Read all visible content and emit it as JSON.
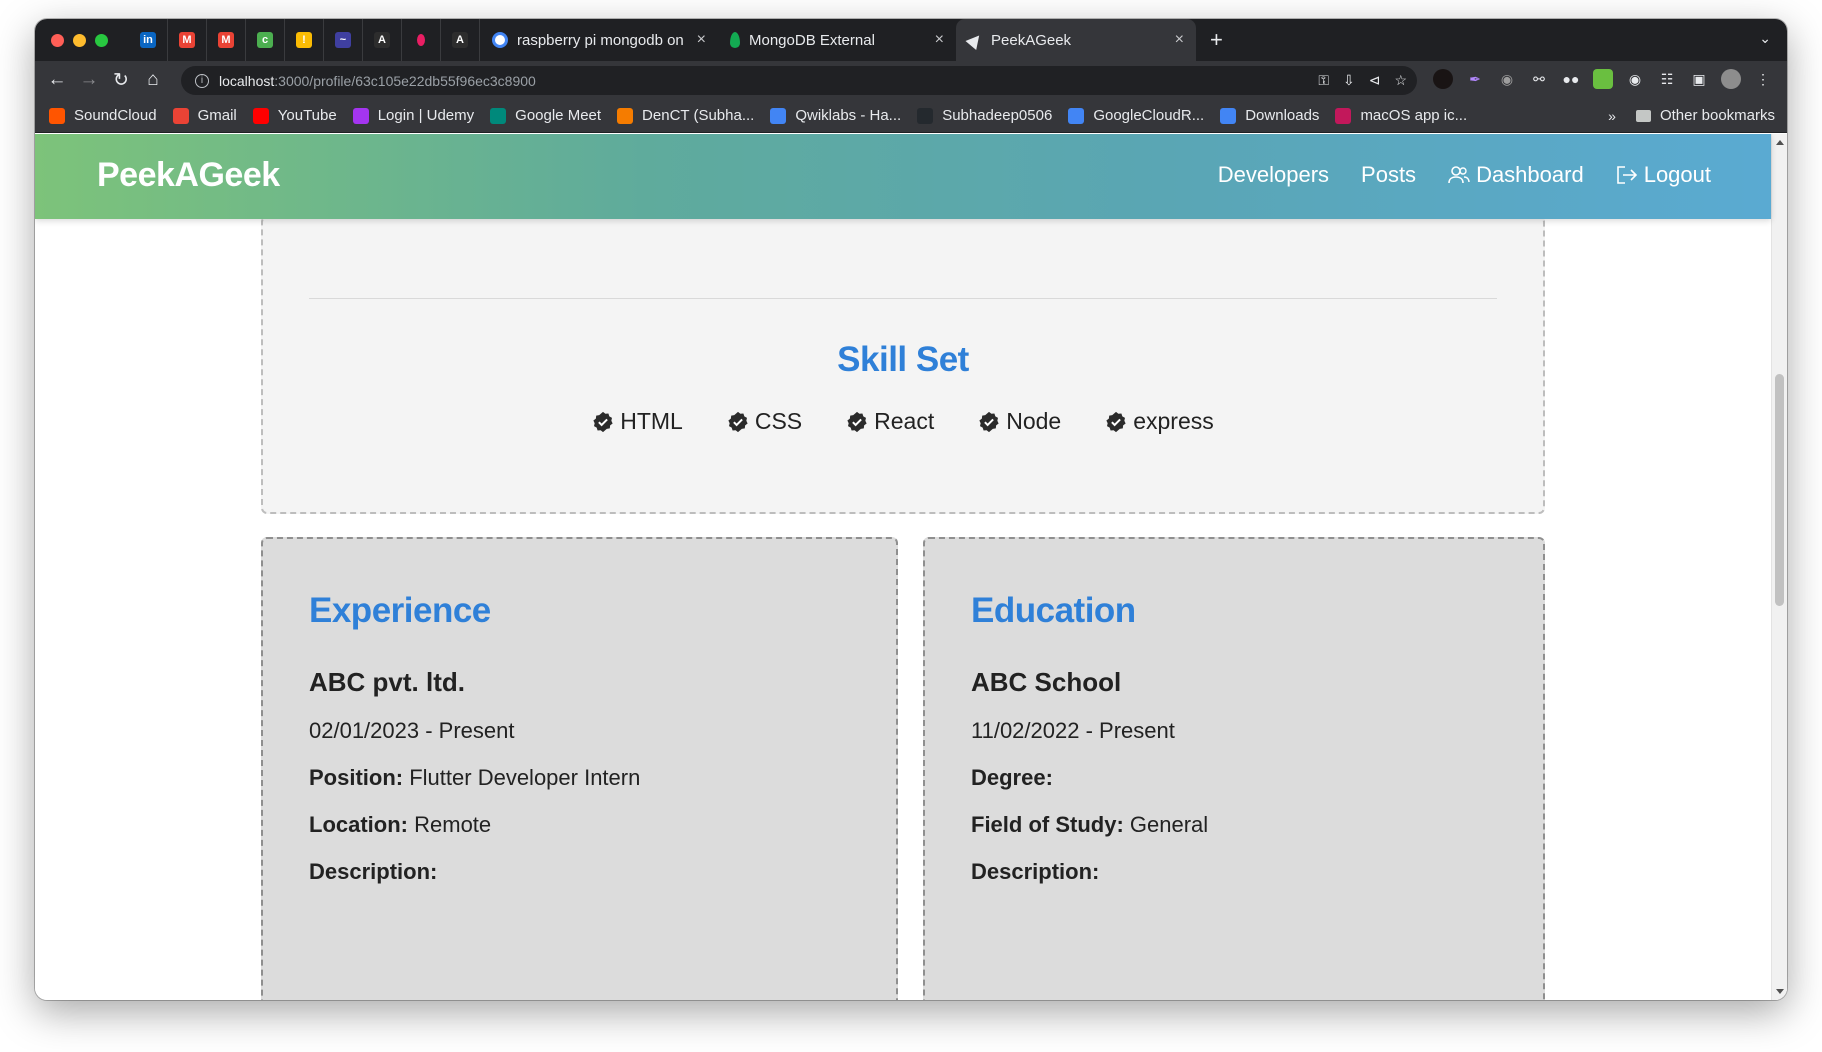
{
  "browser": {
    "tabs": [
      {
        "title": "raspberry pi mongodb on",
        "close": "×"
      },
      {
        "title": "MongoDB External",
        "close": "×"
      },
      {
        "title": "PeekAGeek",
        "close": "×"
      }
    ],
    "new_tab": "+",
    "url_host": "localhost",
    "url_path": ":3000/profile/63c105e22db55f96ec3c8900",
    "bookmarks": [
      {
        "label": "SoundCloud",
        "color": "#ff5500"
      },
      {
        "label": "Gmail",
        "color": "#ea4335"
      },
      {
        "label": "YouTube",
        "color": "#ff0000"
      },
      {
        "label": "Login | Udemy",
        "color": "#a435f0"
      },
      {
        "label": "Google Meet",
        "color": "#00897b"
      },
      {
        "label": "DenCT (Subha...",
        "color": "#f57c00"
      },
      {
        "label": "Qwiklabs - Ha...",
        "color": "#4285f4"
      },
      {
        "label": "Subhadeep0506",
        "color": "#24292e"
      },
      {
        "label": "GoogleCloudR...",
        "color": "#4285f4"
      },
      {
        "label": "Downloads",
        "color": "#4285f4"
      },
      {
        "label": "macOS app ic...",
        "color": "#c2185b"
      }
    ],
    "bookmarks_more": "»",
    "other_bookmarks": "Other bookmarks"
  },
  "site": {
    "brand": "PeekAGeek",
    "nav": {
      "developers": "Developers",
      "posts": "Posts",
      "dashboard": "Dashboard",
      "logout": "Logout"
    }
  },
  "skills": {
    "title": "Skill Set",
    "items": [
      "HTML",
      "CSS",
      "React",
      "Node",
      "express"
    ]
  },
  "experience": {
    "title": "Experience",
    "company": "ABC pvt. ltd.",
    "dates": "02/01/2023 - Present",
    "position_label": "Position:",
    "position": "Flutter Developer Intern",
    "location_label": "Location:",
    "location": "Remote",
    "description_label": "Description:"
  },
  "education": {
    "title": "Education",
    "school": "ABC School",
    "dates": "11/02/2022 - Present",
    "degree_label": "Degree:",
    "field_label": "Field of Study:",
    "field": "General",
    "description_label": "Description:"
  },
  "colors": {
    "accent": "#2f80d8",
    "navbar_start": "#7dc37a",
    "navbar_end": "#5aaad2"
  }
}
